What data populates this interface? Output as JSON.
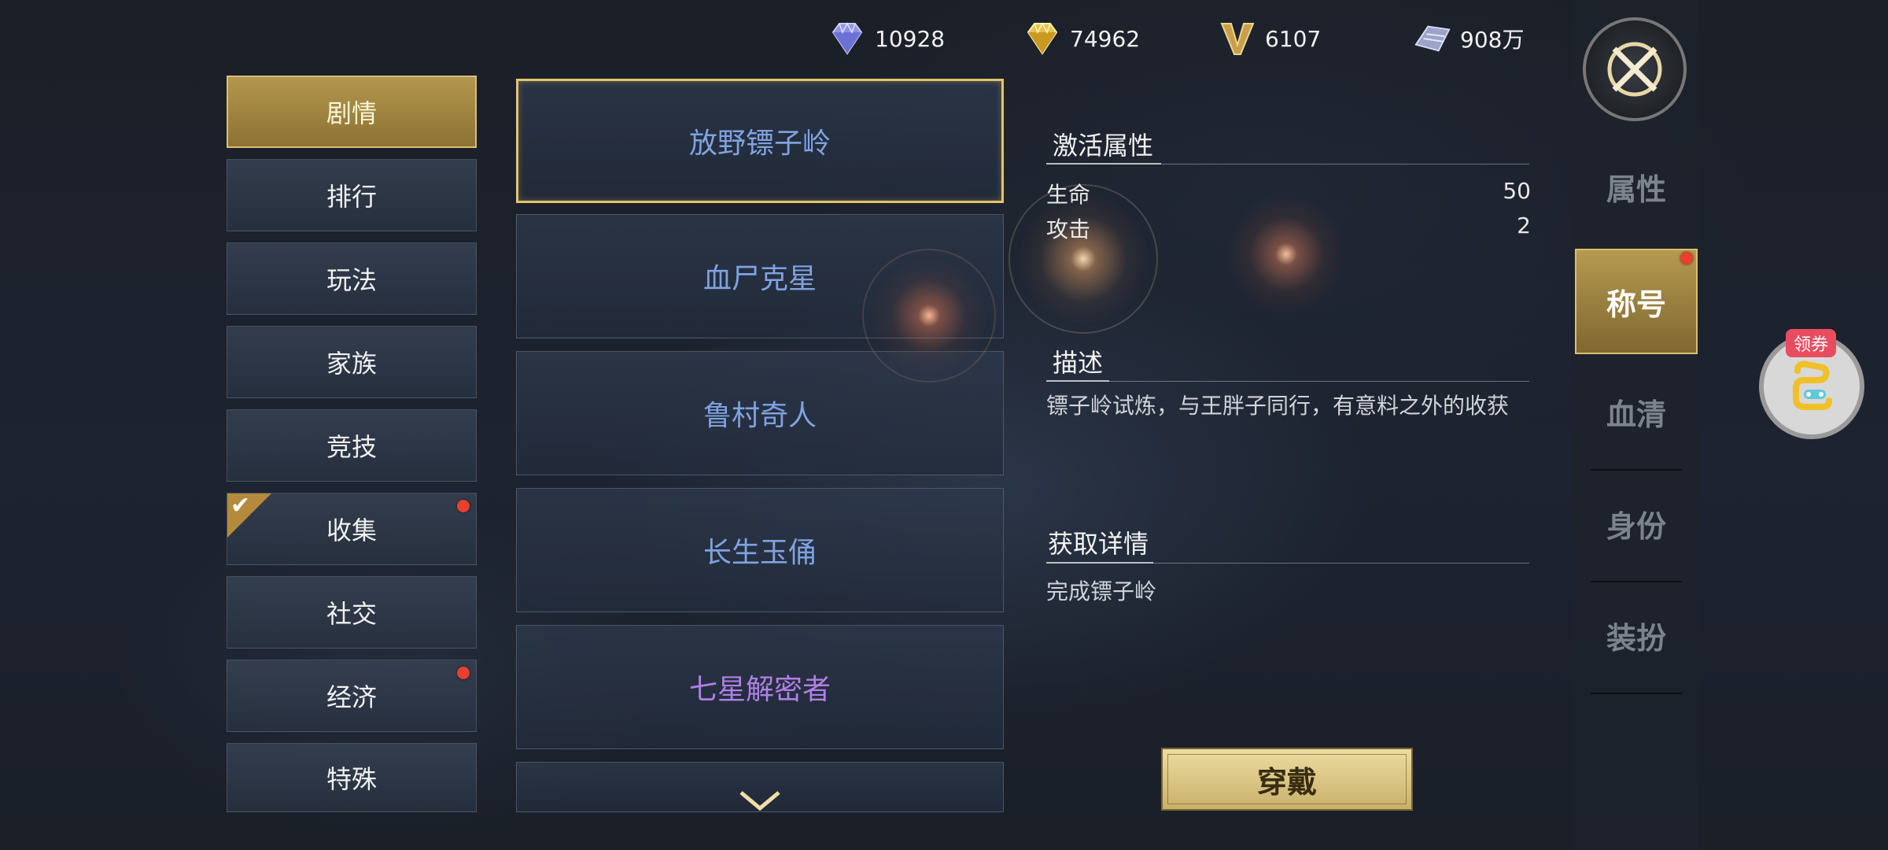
{
  "currencies": [
    {
      "icon": "purple-diamond-icon",
      "value": "10928",
      "color": "#8f93e8"
    },
    {
      "icon": "gold-diamond-icon",
      "value": "74962",
      "color": "#e8c24a"
    },
    {
      "icon": "v-points-icon",
      "value": "6107",
      "color": "#c9a04a"
    },
    {
      "icon": "silver-ingot-icon",
      "value": "908万",
      "color": "#9aa4c8"
    }
  ],
  "categories": [
    {
      "label": "剧情",
      "active": true
    },
    {
      "label": "排行"
    },
    {
      "label": "玩法"
    },
    {
      "label": "家族"
    },
    {
      "label": "竞技"
    },
    {
      "label": "收集",
      "badge": true,
      "checked": true
    },
    {
      "label": "社交"
    },
    {
      "label": "经济",
      "badge": true
    },
    {
      "label": "特殊"
    }
  ],
  "titles": [
    {
      "label": "放野镖子岭",
      "color": "#7fa2e0",
      "selected": true
    },
    {
      "label": "血尸克星",
      "color": "#7fa2e0"
    },
    {
      "label": "鲁村奇人",
      "color": "#7fa2e0"
    },
    {
      "label": "长生玉俑",
      "color": "#7fa2e0"
    },
    {
      "label": "七星解密者",
      "color": "#b07fe6"
    }
  ],
  "detail": {
    "attr_heading": "激活属性",
    "stats": [
      {
        "name": "生命",
        "value": "50"
      },
      {
        "name": "攻击",
        "value": "2"
      }
    ],
    "desc_heading": "描述",
    "desc_text": "镖子岭试炼，与王胖子同行，有意料之外的收获",
    "obtain_heading": "获取详情",
    "obtain_text": "完成镖子岭",
    "wear_button": "穿戴"
  },
  "right_nav": [
    {
      "label": "属性"
    },
    {
      "label": "称号",
      "active": true,
      "badge": true
    },
    {
      "label": "血清"
    },
    {
      "label": "身份"
    },
    {
      "label": "装扮"
    }
  ],
  "coupon_label": "领券",
  "accent_gold": "#d8bf78"
}
